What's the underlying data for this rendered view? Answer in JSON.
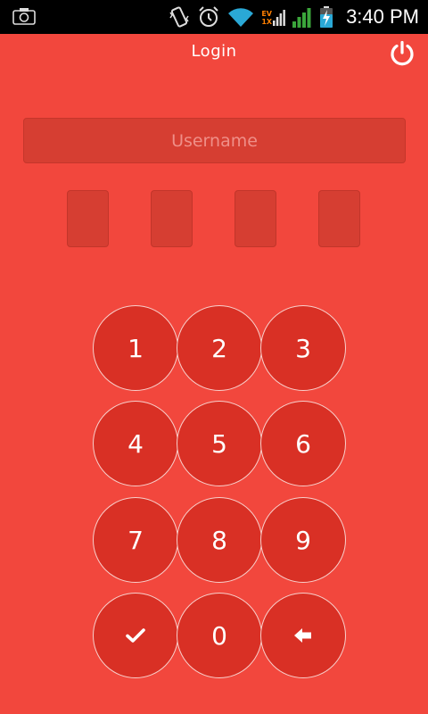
{
  "status_bar": {
    "time": "3:40 PM",
    "network_top": "EV",
    "network_bottom": "1X",
    "icons": [
      "camera-icon",
      "vibrate-icon",
      "alarm-icon",
      "wifi-icon",
      "evdo-signal-icon",
      "cell-signal-icon",
      "battery-charging-icon"
    ]
  },
  "header": {
    "title": "Login",
    "power_icon": "power-icon"
  },
  "username": {
    "placeholder": "Username",
    "value": ""
  },
  "pin": {
    "length": 4,
    "entered": ""
  },
  "keypad": {
    "keys": [
      "1",
      "2",
      "3",
      "4",
      "5",
      "6",
      "7",
      "8",
      "9",
      "✓",
      "0",
      "←"
    ],
    "confirm_icon": "check-icon",
    "backspace_icon": "backspace-arrow-icon"
  },
  "colors": {
    "background": "#f2473d",
    "field": "#d63e32",
    "key": "#d93025",
    "key_border": "#f8d0cc",
    "text": "#ffffff"
  }
}
